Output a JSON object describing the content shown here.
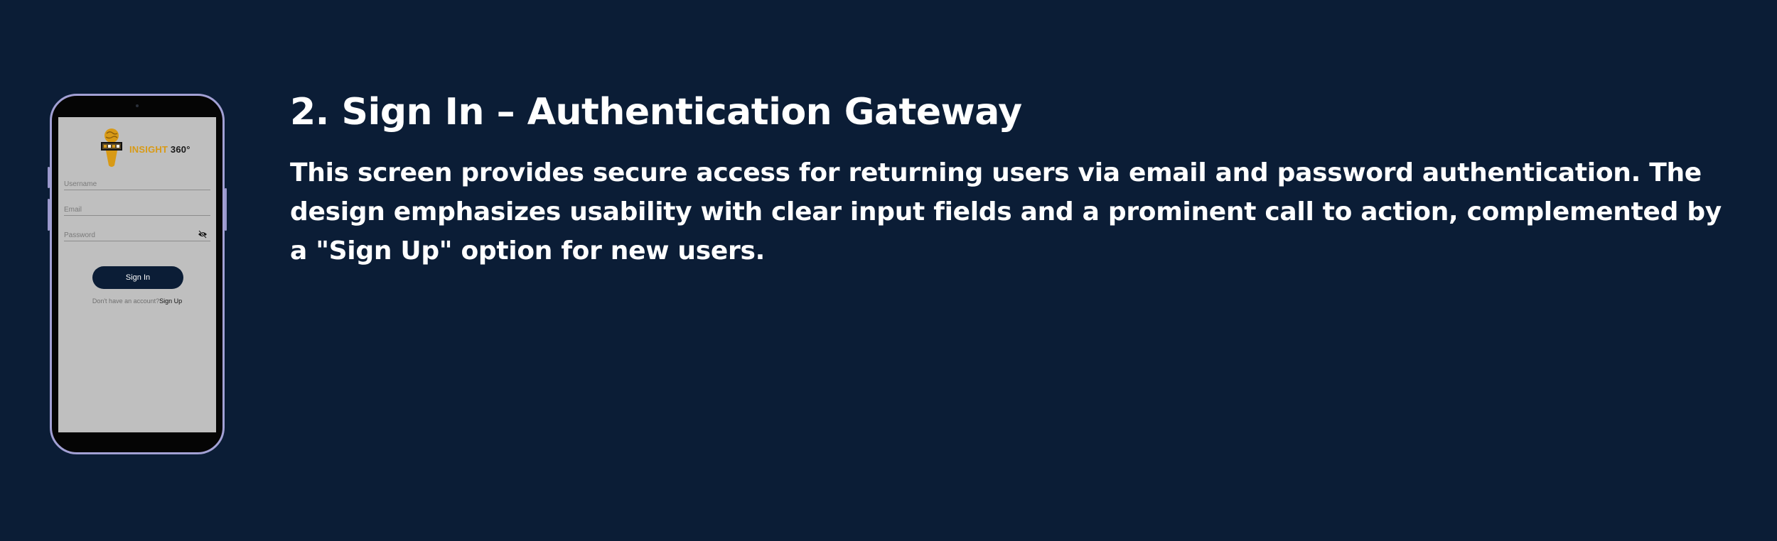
{
  "slide": {
    "heading": "2. Sign In – Authentication Gateway",
    "description": "This screen provides secure access for returning users via email and password authentication. The design emphasizes usability with clear input fields and a prominent call to action, complemented by a \"Sign Up\" option for new users."
  },
  "app": {
    "logo": {
      "brand": "INSIGHT",
      "suffix": " 360°",
      "icon": "microphone-globe-icon"
    },
    "fields": {
      "username_placeholder": "Username",
      "email_placeholder": "Email",
      "password_placeholder": "Password",
      "password_toggle_icon": "eye-off-icon"
    },
    "signin_label": "Sign In",
    "signup_prompt": "Don't have an account?",
    "signup_link": "Sign Up"
  },
  "colors": {
    "background": "#0b1d36",
    "screen": "#bfbfbf",
    "phone_frame": "#a2a0d4",
    "brand_accent": "#d89a16",
    "button": "#0b1d36"
  }
}
